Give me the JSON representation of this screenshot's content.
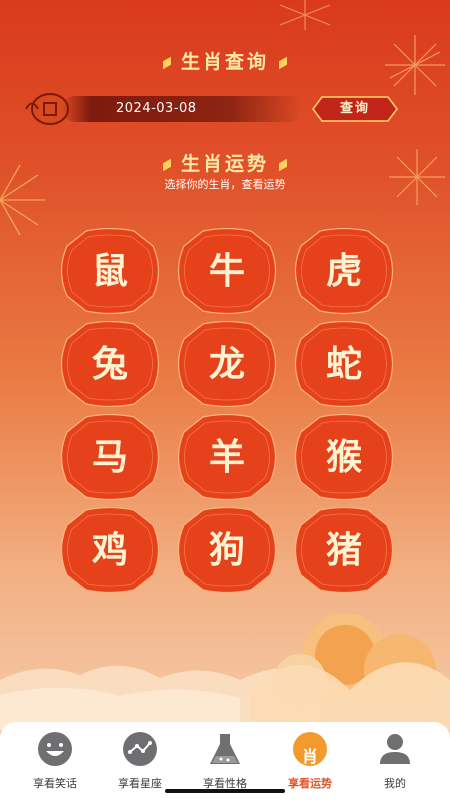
{
  "query_section": {
    "title": "生肖查询",
    "date_value": "2024-03-08",
    "query_button": "查询"
  },
  "fortune_section": {
    "title": "生肖运势",
    "subtitle": "选择你的生肖，查看运势"
  },
  "zodiacs": [
    "鼠",
    "牛",
    "虎",
    "兔",
    "龙",
    "蛇",
    "马",
    "羊",
    "猴",
    "鸡",
    "狗",
    "猪"
  ],
  "tabs": [
    {
      "label": "享看笑话",
      "icon": "smile-face-icon"
    },
    {
      "label": "享看星座",
      "icon": "constellation-icon"
    },
    {
      "label": "享看性格",
      "icon": "flask-icon"
    },
    {
      "label": "享看运势",
      "icon": "zodiac-badge-icon",
      "badge": "肖",
      "active": true
    },
    {
      "label": "我的",
      "icon": "user-icon"
    }
  ],
  "colors": {
    "accent": "#e0552a",
    "gold": "#ffe7a6",
    "tile": "#e6431c",
    "inactive_icon": "#6f6f72"
  }
}
